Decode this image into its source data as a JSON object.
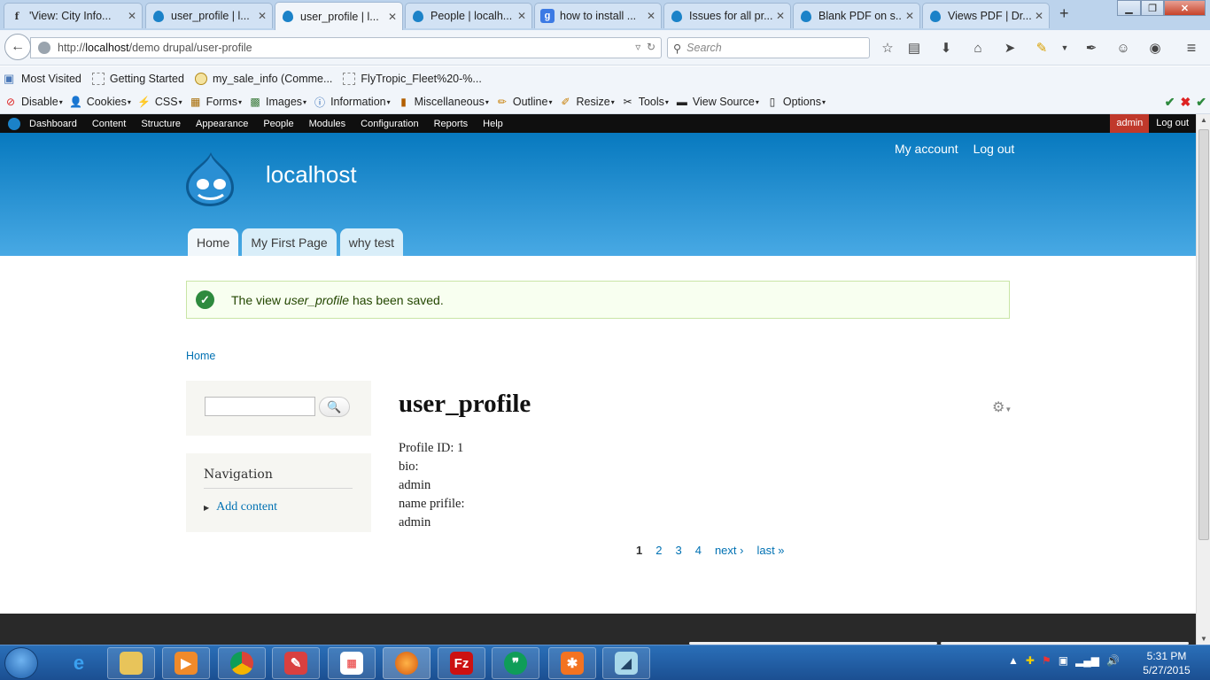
{
  "browser": {
    "tabs": [
      {
        "title": "'View: City Info...",
        "favicon": "f"
      },
      {
        "title": "user_profile | l...",
        "favicon": "drupal"
      },
      {
        "title": "user_profile | l...",
        "favicon": "drupal",
        "active": true
      },
      {
        "title": "People | localh...",
        "favicon": "drupal"
      },
      {
        "title": "how to install ...",
        "favicon": "google"
      },
      {
        "title": "Issues for all pr...",
        "favicon": "drupal"
      },
      {
        "title": "Blank PDF on s...",
        "favicon": "drupal"
      },
      {
        "title": "Views PDF | Dr...",
        "favicon": "drupal"
      }
    ],
    "url_prefix": "http://",
    "url_host": "localhost",
    "url_path": "/demo drupal/user-profile",
    "search_placeholder": "Search",
    "bookmarks": [
      "Most Visited",
      "Getting Started",
      "my_sale_info (Comme...",
      "FlyTropic_Fleet%20-%..."
    ],
    "devtools": [
      "Disable",
      "Cookies",
      "CSS",
      "Forms",
      "Images",
      "Information",
      "Miscellaneous",
      "Outline",
      "Resize",
      "Tools",
      "View Source",
      "Options"
    ]
  },
  "admin_toolbar": {
    "items": [
      "Dashboard",
      "Content",
      "Structure",
      "Appearance",
      "People",
      "Modules",
      "Configuration",
      "Reports",
      "Help"
    ],
    "user": "admin",
    "logout": "Log out"
  },
  "site": {
    "name": "localhost",
    "secondary_menu": [
      "My account",
      "Log out"
    ],
    "main_menu": [
      "Home",
      "My First Page",
      "why test"
    ]
  },
  "message": {
    "before": "The view ",
    "em": "user_profile",
    "after": " has been saved."
  },
  "breadcrumb": "Home",
  "sidebar": {
    "nav_title": "Navigation",
    "nav_items": [
      "Add content"
    ]
  },
  "content": {
    "title": "user_profile",
    "fields": [
      "Profile ID: 1",
      "bio:",
      "admin",
      "name prifile:",
      "admin"
    ]
  },
  "pager": {
    "pages": [
      "1",
      "2",
      "3",
      "4"
    ],
    "current": "1",
    "next": "next ›",
    "last": "last »"
  },
  "clock": {
    "time": "5:31 PM",
    "date": "5/27/2015"
  },
  "colors": {
    "header_top": "#0779bf",
    "header_bottom": "#48a9e4",
    "link": "#0071b3",
    "admin_badge": "#c0392b",
    "status_green": "#2e8a3e"
  }
}
